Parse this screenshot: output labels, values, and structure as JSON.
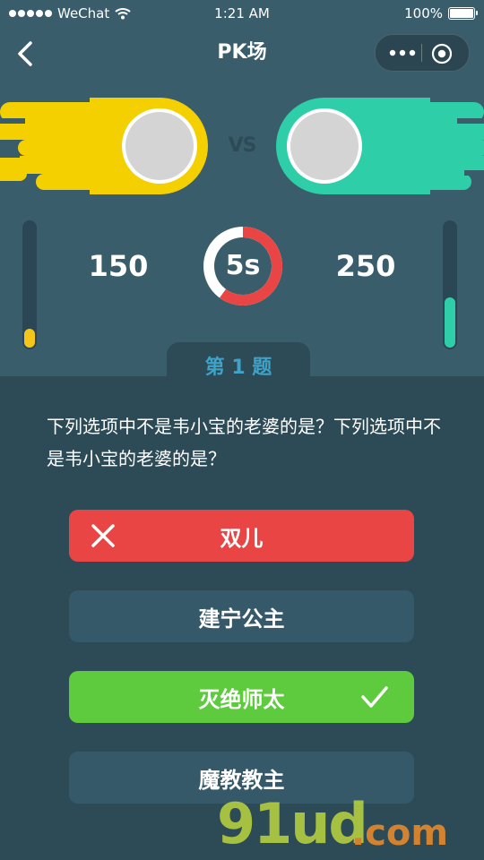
{
  "status_bar": {
    "carrier": "WeChat",
    "time": "1:21 AM",
    "battery": "100%"
  },
  "nav": {
    "title": "PK场"
  },
  "battle": {
    "vs_label": "VS",
    "left_score": "150",
    "right_score": "250",
    "timer": "5s",
    "timer_progress": 0.6,
    "left_bar_level": 0.15,
    "right_bar_level": 0.4,
    "left_color": "#f5d000",
    "right_color": "#2ecfa8"
  },
  "question": {
    "tab_label": "第 1 题",
    "text": "下列选项中不是韦小宝的老婆的是？下列选项中不是韦小宝的老婆的是？"
  },
  "options": [
    {
      "label": "双儿",
      "state": "wrong",
      "icon": "close-icon"
    },
    {
      "label": "建宁公主",
      "state": "default"
    },
    {
      "label": "灭绝师太",
      "state": "correct",
      "icon": "check-icon"
    },
    {
      "label": "魔教教主",
      "state": "default"
    }
  ],
  "watermark": {
    "main": "91ud",
    "suffix": ".com"
  }
}
